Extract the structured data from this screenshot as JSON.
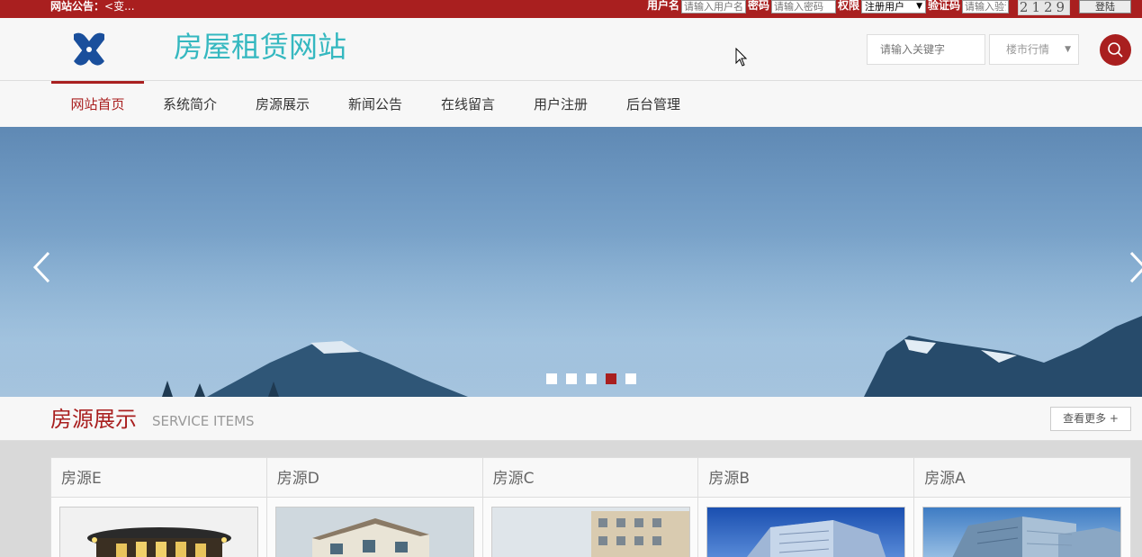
{
  "topbar": {
    "notice_label": "网站公告：",
    "notice_text": "<变...",
    "username_label": "用户名",
    "username_placeholder": "请输入用户名",
    "password_label": "密码",
    "password_placeholder": "请输入密码",
    "role_label": "权限",
    "role_value": "注册用户",
    "captcha_label": "验证码",
    "captcha_placeholder": "请输入验证码",
    "captcha_code": "2129",
    "login_label": "登陆"
  },
  "header": {
    "site_title": "房屋租赁网站",
    "keyword_placeholder": "请输入关键字",
    "market_select": "楼市行情"
  },
  "nav": {
    "items": [
      {
        "label": "网站首页",
        "active": true
      },
      {
        "label": "系统简介"
      },
      {
        "label": "房源展示"
      },
      {
        "label": "新闻公告"
      },
      {
        "label": "在线留言"
      },
      {
        "label": "用户注册"
      },
      {
        "label": "后台管理"
      }
    ]
  },
  "banner": {
    "slide_count": 5,
    "active_slide": 4
  },
  "section": {
    "title": "房源展示",
    "subtitle": "SERVICE ITEMS",
    "more_label": "查看更多 +"
  },
  "listings": [
    {
      "title": "房源E"
    },
    {
      "title": "房源D"
    },
    {
      "title": "房源C"
    },
    {
      "title": "房源B"
    },
    {
      "title": "房源A"
    }
  ],
  "colors": {
    "brand_red": "#a91f1f",
    "title_teal": "#35b8c0",
    "logo_blue": "#1a4f9c"
  }
}
